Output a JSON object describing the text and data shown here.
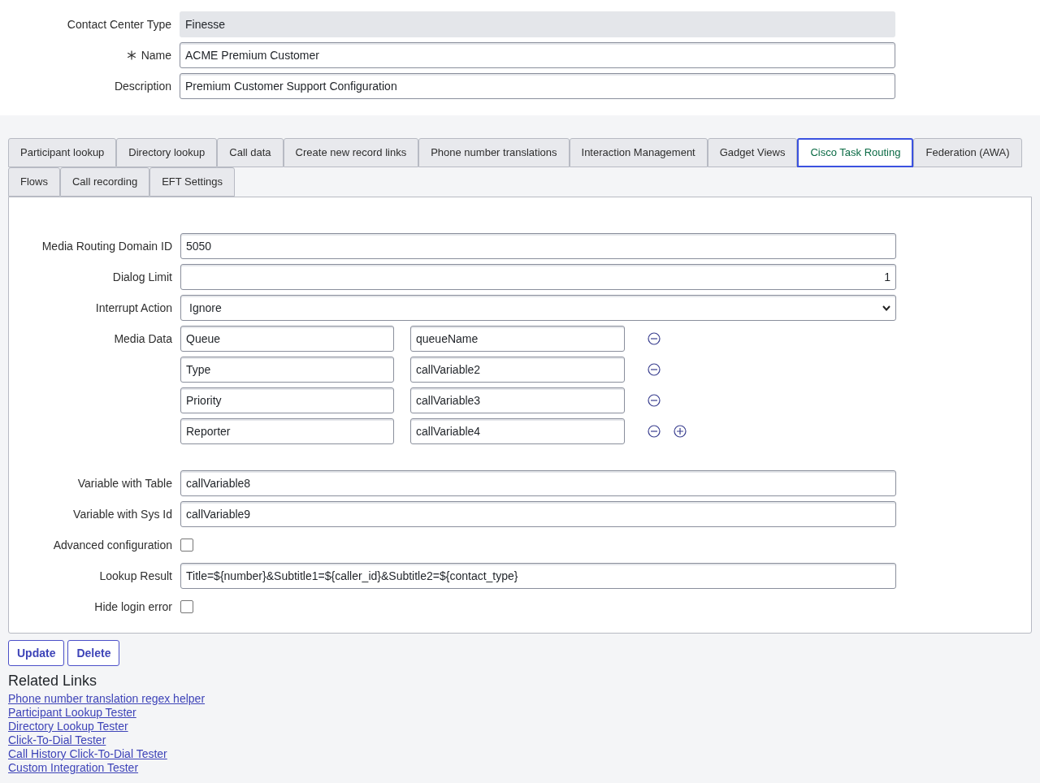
{
  "header_fields": [
    {
      "label": "Contact Center Type",
      "value": "Finesse",
      "kind": "readonly",
      "required": false
    },
    {
      "label": "Name",
      "value": "ACME Premium Customer",
      "kind": "input",
      "required": true
    },
    {
      "label": "Description",
      "value": "Premium Customer Support Configuration",
      "kind": "input",
      "required": false
    }
  ],
  "tabs": [
    {
      "label": "Participant lookup",
      "selected": false
    },
    {
      "label": "Directory lookup",
      "selected": false
    },
    {
      "label": "Call data",
      "selected": false
    },
    {
      "label": "Create new record links",
      "selected": false
    },
    {
      "label": "Phone number translations",
      "selected": false
    },
    {
      "label": "Interaction Management",
      "selected": false
    },
    {
      "label": "Gadget Views",
      "selected": false
    },
    {
      "label": "Cisco Task Routing",
      "selected": true
    },
    {
      "label": "Federation (AWA)",
      "selected": false
    },
    {
      "label": "Flows",
      "selected": false
    },
    {
      "label": "Call recording",
      "selected": false
    },
    {
      "label": "EFT Settings",
      "selected": false
    }
  ],
  "panel": {
    "top_fields": [
      {
        "label": "Media Routing Domain ID",
        "value": "5050",
        "kind": "input"
      },
      {
        "label": "Dialog Limit",
        "value": "1",
        "kind": "number"
      },
      {
        "label": "Interrupt Action",
        "value": "Ignore",
        "kind": "select"
      }
    ],
    "media_data": {
      "label": "Media Data",
      "rows": [
        {
          "name": "Queue",
          "variable": "queueName",
          "can_add": false
        },
        {
          "name": "Type",
          "variable": "callVariable2",
          "can_add": false
        },
        {
          "name": "Priority",
          "variable": "callVariable3",
          "can_add": false
        },
        {
          "name": "Reporter",
          "variable": "callVariable4",
          "can_add": true
        }
      ]
    },
    "bottom_fields": [
      {
        "label": "Variable with Table",
        "value": "callVariable8",
        "kind": "input"
      },
      {
        "label": "Variable with Sys Id",
        "value": "callVariable9",
        "kind": "input"
      },
      {
        "label": "Advanced configuration",
        "kind": "checkbox",
        "checked": false
      },
      {
        "label": "Lookup Result",
        "value": "Title=${number}&Subtitle1=${caller_id}&Subtitle2=${contact_type}",
        "kind": "input"
      },
      {
        "label": "Hide login error",
        "kind": "checkbox",
        "checked": false
      }
    ]
  },
  "buttons": [
    "Update",
    "Delete"
  ],
  "related_links": {
    "title": "Related Links",
    "links": [
      "Phone number translation regex helper",
      "Participant Lookup Tester",
      "Directory Lookup Tester",
      "Click-To-Dial Tester",
      "Call History Click-To-Dial Tester",
      "Custom Integration Tester"
    ]
  }
}
